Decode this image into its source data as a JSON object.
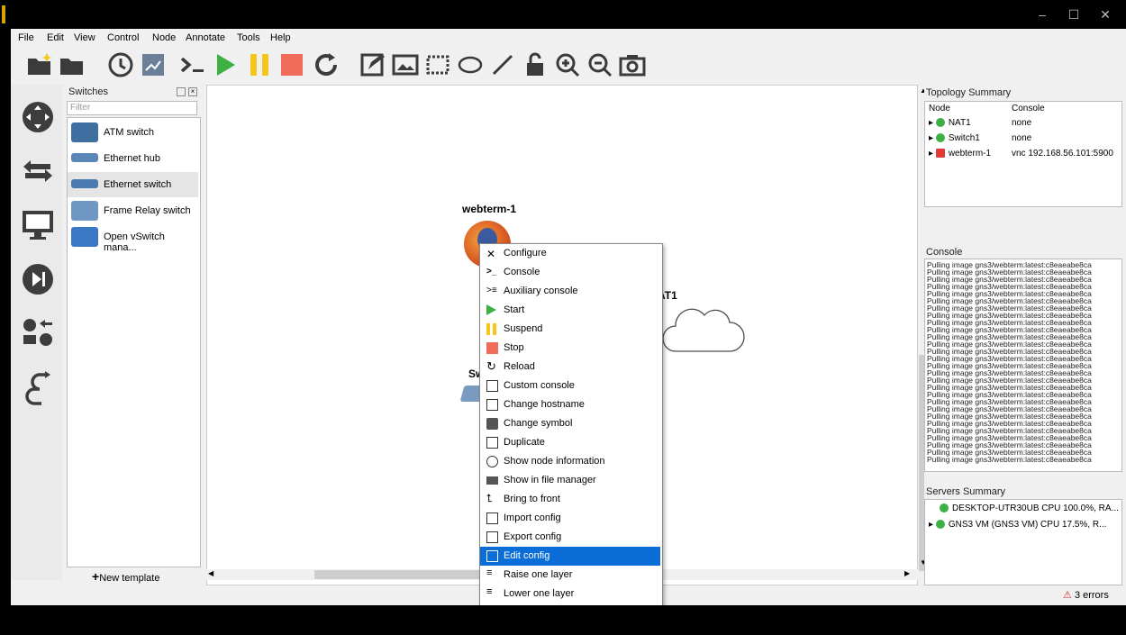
{
  "window": {
    "minimize": "–",
    "maximize": "☐",
    "close": "✕"
  },
  "menubar": [
    "File",
    "Edit",
    "View",
    "Control",
    "Node",
    "Annotate",
    "Tools",
    "Help"
  ],
  "switches_panel": {
    "title": "Switches",
    "filter_placeholder": "Filter",
    "items": [
      "ATM switch",
      "Ethernet hub",
      "Ethernet switch",
      "Frame Relay switch",
      "Open vSwitch mana..."
    ],
    "new_template": "New template"
  },
  "canvas": {
    "node_webterm": "webterm-1",
    "node_nat_partial": "AT1",
    "node_switch_partial": "Swi"
  },
  "context_menu": {
    "items": [
      "Configure",
      "Console",
      "Auxiliary console",
      "Start",
      "Suspend",
      "Stop",
      "Reload",
      "Custom console",
      "Change hostname",
      "Change symbol",
      "Duplicate",
      "Show node information",
      "Show in file manager",
      "Bring to front",
      "Import config",
      "Export config",
      "Edit config",
      "Raise one layer",
      "Lower one layer"
    ],
    "selected": "Edit config"
  },
  "topology_summary": {
    "title": "Topology Summary",
    "col_node": "Node",
    "col_console": "Console",
    "rows": [
      {
        "node": "NAT1",
        "console": "none",
        "status_color": "#3cb043"
      },
      {
        "node": "Switch1",
        "console": "none",
        "status_color": "#3cb043"
      },
      {
        "node": "webterm-1",
        "console": "vnc 192.168.56.101:5900",
        "status_color": "#e53935"
      }
    ]
  },
  "console": {
    "title": "Console",
    "lines": [
      "Pulling image gns3/webterm:latest:c8eaeabe8ca",
      "Pulling image gns3/webterm:latest:c8eaeabe8ca",
      "Pulling image gns3/webterm:latest:c8eaeabe8ca",
      "Pulling image gns3/webterm:latest:c8eaeabe8ca",
      "Pulling image gns3/webterm:latest:c8eaeabe8ca",
      "Pulling image gns3/webterm:latest:c8eaeabe8ca",
      "Pulling image gns3/webterm:latest:c8eaeabe8ca",
      "Pulling image gns3/webterm:latest:c8eaeabe8ca",
      "Pulling image gns3/webterm:latest:c8eaeabe8ca",
      "Pulling image gns3/webterm:latest:c8eaeabe8ca",
      "Pulling image gns3/webterm:latest:c8eaeabe8ca",
      "Pulling image gns3/webterm:latest:c8eaeabe8ca",
      "Pulling image gns3/webterm:latest:c8eaeabe8ca",
      "Pulling image gns3/webterm:latest:c8eaeabe8ca",
      "Pulling image gns3/webterm:latest:c8eaeabe8ca",
      "Pulling image gns3/webterm:latest:c8eaeabe8ca",
      "Pulling image gns3/webterm:latest:c8eaeabe8ca",
      "Pulling image gns3/webterm:latest:c8eaeabe8ca",
      "Pulling image gns3/webterm:latest:c8eaeabe8ca",
      "Pulling image gns3/webterm:latest:c8eaeabe8ca",
      "Pulling image gns3/webterm:latest:c8eaeabe8ca",
      "Pulling image gns3/webterm:latest:c8eaeabe8ca",
      "Pulling image gns3/webterm:latest:c8eaeabe8ca",
      "Pulling image gns3/webterm:latest:c8eaeabe8ca",
      "Pulling image gns3/webterm:latest:c8eaeabe8ca",
      "Pulling image gns3/webterm:latest:c8eaeabe8ca",
      "Pulling image gns3/webterm:latest:c8eaeabe8ca",
      "Pulling image gns3/webterm:latest:c8eaeabe8ca"
    ]
  },
  "servers_summary": {
    "title": "Servers Summary",
    "rows": [
      {
        "label": "DESKTOP-UTR30UB CPU 100.0%, RA...",
        "status_color": "#3cb043"
      },
      {
        "label": "GNS3 VM (GNS3 VM) CPU 17.5%, R...",
        "status_color": "#3cb043"
      }
    ]
  },
  "status": {
    "errors": "3 errors"
  },
  "colors": {
    "selected": "#0a6dd8",
    "accent_green": "#3cb043",
    "stop_red": "#ef6c5b",
    "suspend_yellow": "#f5c518"
  }
}
